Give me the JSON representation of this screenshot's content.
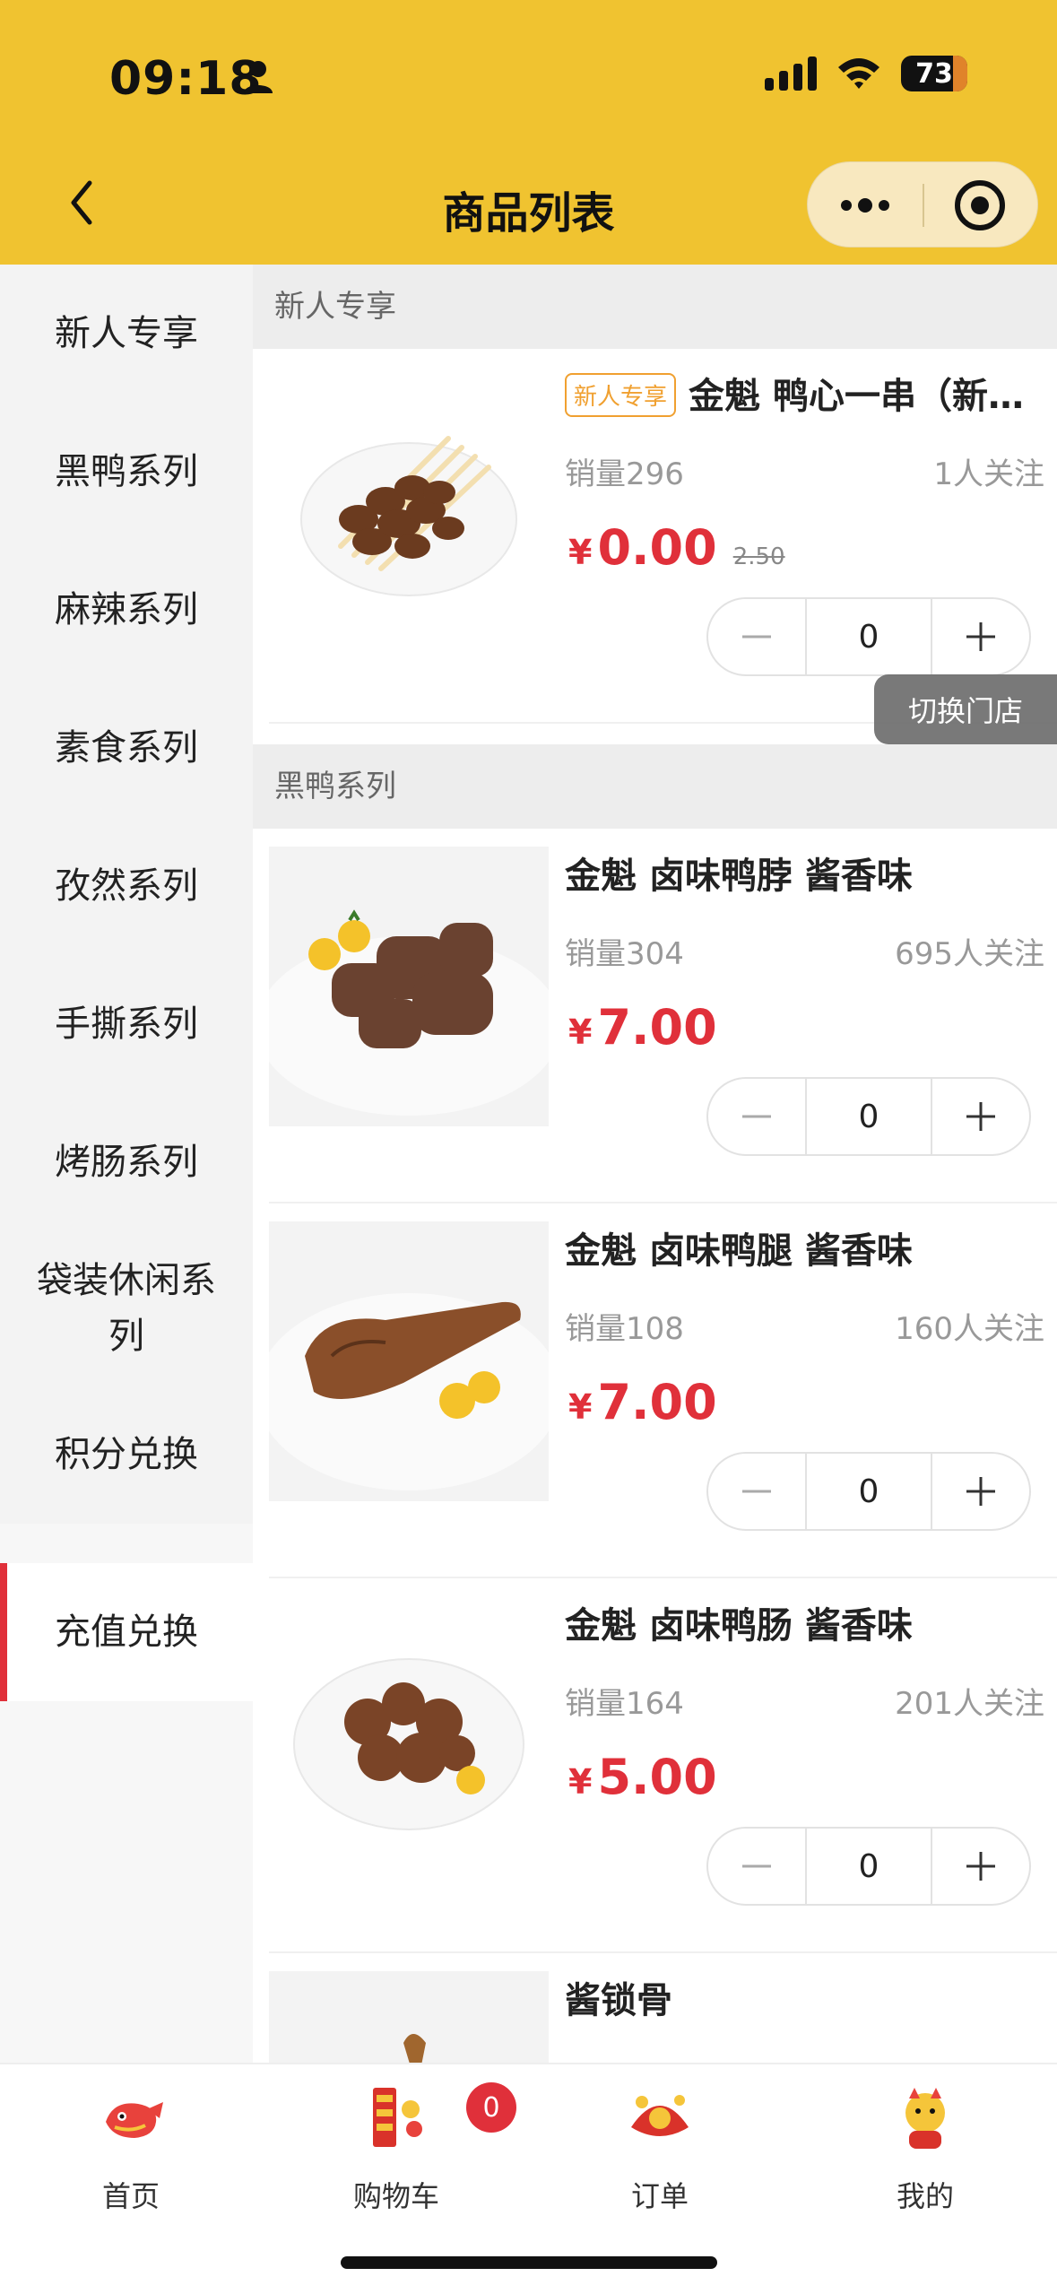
{
  "status_bar": {
    "time": "09:18",
    "battery": "73"
  },
  "nav": {
    "title": "商品列表"
  },
  "sidebar": {
    "items": [
      {
        "label": "新人专享"
      },
      {
        "label": "黑鸭系列"
      },
      {
        "label": "麻辣系列"
      },
      {
        "label": "素食系列"
      },
      {
        "label": "孜然系列"
      },
      {
        "label": "手撕系列"
      },
      {
        "label": "烤肠系列"
      },
      {
        "label": "袋装休闲系列"
      },
      {
        "label": "积分兑换"
      },
      {
        "label": "充值兑换"
      }
    ],
    "active": "充值兑换"
  },
  "sections": [
    {
      "title": "新人专享",
      "products": [
        {
          "tag": "新人专享",
          "name": "金魁 鸭心一串（新人专享）",
          "sales": "销量296",
          "follow": "1人关注",
          "currency": "¥",
          "price": "0.00",
          "old_price": "2.50",
          "qty": "0"
        }
      ]
    },
    {
      "title": "黑鸭系列",
      "products": [
        {
          "name": "金魁 卤味鸭脖 酱香味",
          "sales": "销量304",
          "follow": "695人关注",
          "currency": "¥",
          "price": "7.00",
          "qty": "0"
        },
        {
          "name": "金魁 卤味鸭腿 酱香味",
          "sales": "销量108",
          "follow": "160人关注",
          "currency": "¥",
          "price": "7.00",
          "qty": "0"
        },
        {
          "name": "金魁 卤味鸭肠 酱香味",
          "sales": "销量164",
          "follow": "201人关注",
          "currency": "¥",
          "price": "5.00",
          "qty": "0"
        },
        {
          "name": "酱锁骨"
        }
      ]
    }
  ],
  "floating": {
    "switch_store": "切换门店"
  },
  "tabbar": {
    "items": [
      {
        "label": "首页"
      },
      {
        "label": "购物车"
      },
      {
        "label": "订单"
      },
      {
        "label": "我的"
      }
    ],
    "cart_badge": "0"
  },
  "colors": {
    "header": "#f0c330",
    "price": "#e0303a",
    "active_indicator": "#e0303a",
    "tag": "#f0a030"
  }
}
